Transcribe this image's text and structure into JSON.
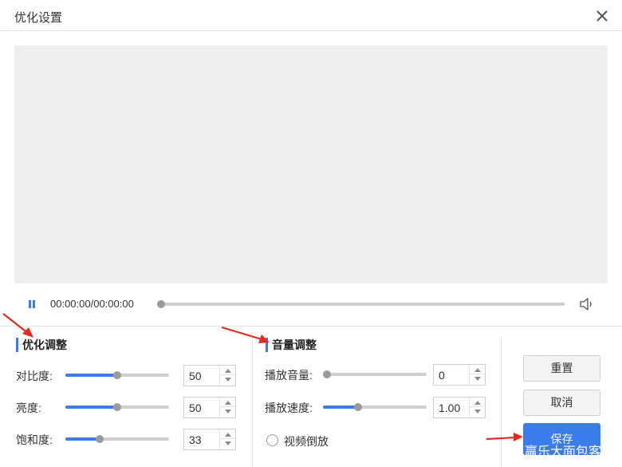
{
  "dialog": {
    "title": "优化设置"
  },
  "player": {
    "timecode": "00:00:00/00:00:00",
    "progress": 0
  },
  "optimize": {
    "title": "优化调整",
    "rows": [
      {
        "label": "对比度:",
        "value": "50",
        "fraction": 0.5
      },
      {
        "label": "亮度:",
        "value": "50",
        "fraction": 0.5
      },
      {
        "label": "饱和度:",
        "value": "33",
        "fraction": 0.33
      }
    ]
  },
  "audio": {
    "title": "音量调整",
    "rows": [
      {
        "label": "播放音量:",
        "value": "0",
        "fraction": 0
      },
      {
        "label": "播放速度:",
        "value": "1.00",
        "fraction": 0.34
      }
    ],
    "reverse_label": "视频倒放"
  },
  "buttons": {
    "reset": "重置",
    "cancel": "取消",
    "save": "保存"
  },
  "watermark": "赢乐大面包客",
  "colors": {
    "accent": "#3b7de8",
    "annotation_arrow": "#e52b20",
    "preview_bg": "#efefef"
  },
  "icons": [
    "close-icon",
    "pause-icon",
    "volume-icon",
    "annotation-arrow"
  ]
}
